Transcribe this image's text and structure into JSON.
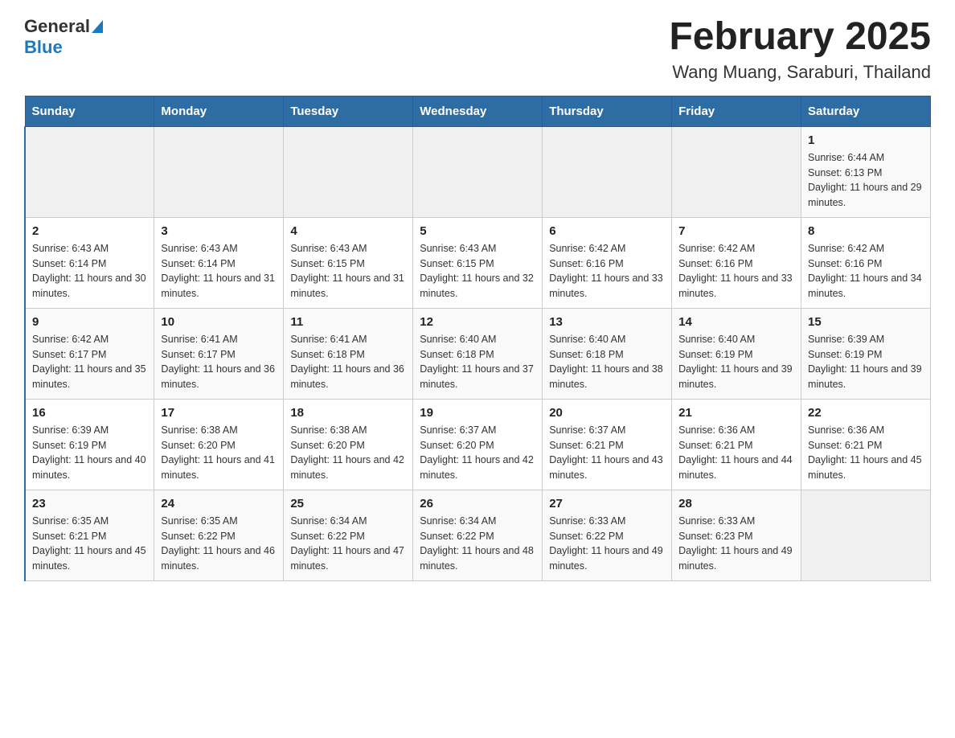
{
  "header": {
    "logo_general": "General",
    "logo_blue": "Blue",
    "title": "February 2025",
    "subtitle": "Wang Muang, Saraburi, Thailand"
  },
  "days_of_week": [
    "Sunday",
    "Monday",
    "Tuesday",
    "Wednesday",
    "Thursday",
    "Friday",
    "Saturday"
  ],
  "weeks": [
    [
      {
        "day": "",
        "info": ""
      },
      {
        "day": "",
        "info": ""
      },
      {
        "day": "",
        "info": ""
      },
      {
        "day": "",
        "info": ""
      },
      {
        "day": "",
        "info": ""
      },
      {
        "day": "",
        "info": ""
      },
      {
        "day": "1",
        "info": "Sunrise: 6:44 AM\nSunset: 6:13 PM\nDaylight: 11 hours and 29 minutes."
      }
    ],
    [
      {
        "day": "2",
        "info": "Sunrise: 6:43 AM\nSunset: 6:14 PM\nDaylight: 11 hours and 30 minutes."
      },
      {
        "day": "3",
        "info": "Sunrise: 6:43 AM\nSunset: 6:14 PM\nDaylight: 11 hours and 31 minutes."
      },
      {
        "day": "4",
        "info": "Sunrise: 6:43 AM\nSunset: 6:15 PM\nDaylight: 11 hours and 31 minutes."
      },
      {
        "day": "5",
        "info": "Sunrise: 6:43 AM\nSunset: 6:15 PM\nDaylight: 11 hours and 32 minutes."
      },
      {
        "day": "6",
        "info": "Sunrise: 6:42 AM\nSunset: 6:16 PM\nDaylight: 11 hours and 33 minutes."
      },
      {
        "day": "7",
        "info": "Sunrise: 6:42 AM\nSunset: 6:16 PM\nDaylight: 11 hours and 33 minutes."
      },
      {
        "day": "8",
        "info": "Sunrise: 6:42 AM\nSunset: 6:16 PM\nDaylight: 11 hours and 34 minutes."
      }
    ],
    [
      {
        "day": "9",
        "info": "Sunrise: 6:42 AM\nSunset: 6:17 PM\nDaylight: 11 hours and 35 minutes."
      },
      {
        "day": "10",
        "info": "Sunrise: 6:41 AM\nSunset: 6:17 PM\nDaylight: 11 hours and 36 minutes."
      },
      {
        "day": "11",
        "info": "Sunrise: 6:41 AM\nSunset: 6:18 PM\nDaylight: 11 hours and 36 minutes."
      },
      {
        "day": "12",
        "info": "Sunrise: 6:40 AM\nSunset: 6:18 PM\nDaylight: 11 hours and 37 minutes."
      },
      {
        "day": "13",
        "info": "Sunrise: 6:40 AM\nSunset: 6:18 PM\nDaylight: 11 hours and 38 minutes."
      },
      {
        "day": "14",
        "info": "Sunrise: 6:40 AM\nSunset: 6:19 PM\nDaylight: 11 hours and 39 minutes."
      },
      {
        "day": "15",
        "info": "Sunrise: 6:39 AM\nSunset: 6:19 PM\nDaylight: 11 hours and 39 minutes."
      }
    ],
    [
      {
        "day": "16",
        "info": "Sunrise: 6:39 AM\nSunset: 6:19 PM\nDaylight: 11 hours and 40 minutes."
      },
      {
        "day": "17",
        "info": "Sunrise: 6:38 AM\nSunset: 6:20 PM\nDaylight: 11 hours and 41 minutes."
      },
      {
        "day": "18",
        "info": "Sunrise: 6:38 AM\nSunset: 6:20 PM\nDaylight: 11 hours and 42 minutes."
      },
      {
        "day": "19",
        "info": "Sunrise: 6:37 AM\nSunset: 6:20 PM\nDaylight: 11 hours and 42 minutes."
      },
      {
        "day": "20",
        "info": "Sunrise: 6:37 AM\nSunset: 6:21 PM\nDaylight: 11 hours and 43 minutes."
      },
      {
        "day": "21",
        "info": "Sunrise: 6:36 AM\nSunset: 6:21 PM\nDaylight: 11 hours and 44 minutes."
      },
      {
        "day": "22",
        "info": "Sunrise: 6:36 AM\nSunset: 6:21 PM\nDaylight: 11 hours and 45 minutes."
      }
    ],
    [
      {
        "day": "23",
        "info": "Sunrise: 6:35 AM\nSunset: 6:21 PM\nDaylight: 11 hours and 45 minutes."
      },
      {
        "day": "24",
        "info": "Sunrise: 6:35 AM\nSunset: 6:22 PM\nDaylight: 11 hours and 46 minutes."
      },
      {
        "day": "25",
        "info": "Sunrise: 6:34 AM\nSunset: 6:22 PM\nDaylight: 11 hours and 47 minutes."
      },
      {
        "day": "26",
        "info": "Sunrise: 6:34 AM\nSunset: 6:22 PM\nDaylight: 11 hours and 48 minutes."
      },
      {
        "day": "27",
        "info": "Sunrise: 6:33 AM\nSunset: 6:22 PM\nDaylight: 11 hours and 49 minutes."
      },
      {
        "day": "28",
        "info": "Sunrise: 6:33 AM\nSunset: 6:23 PM\nDaylight: 11 hours and 49 minutes."
      },
      {
        "day": "",
        "info": ""
      }
    ]
  ]
}
